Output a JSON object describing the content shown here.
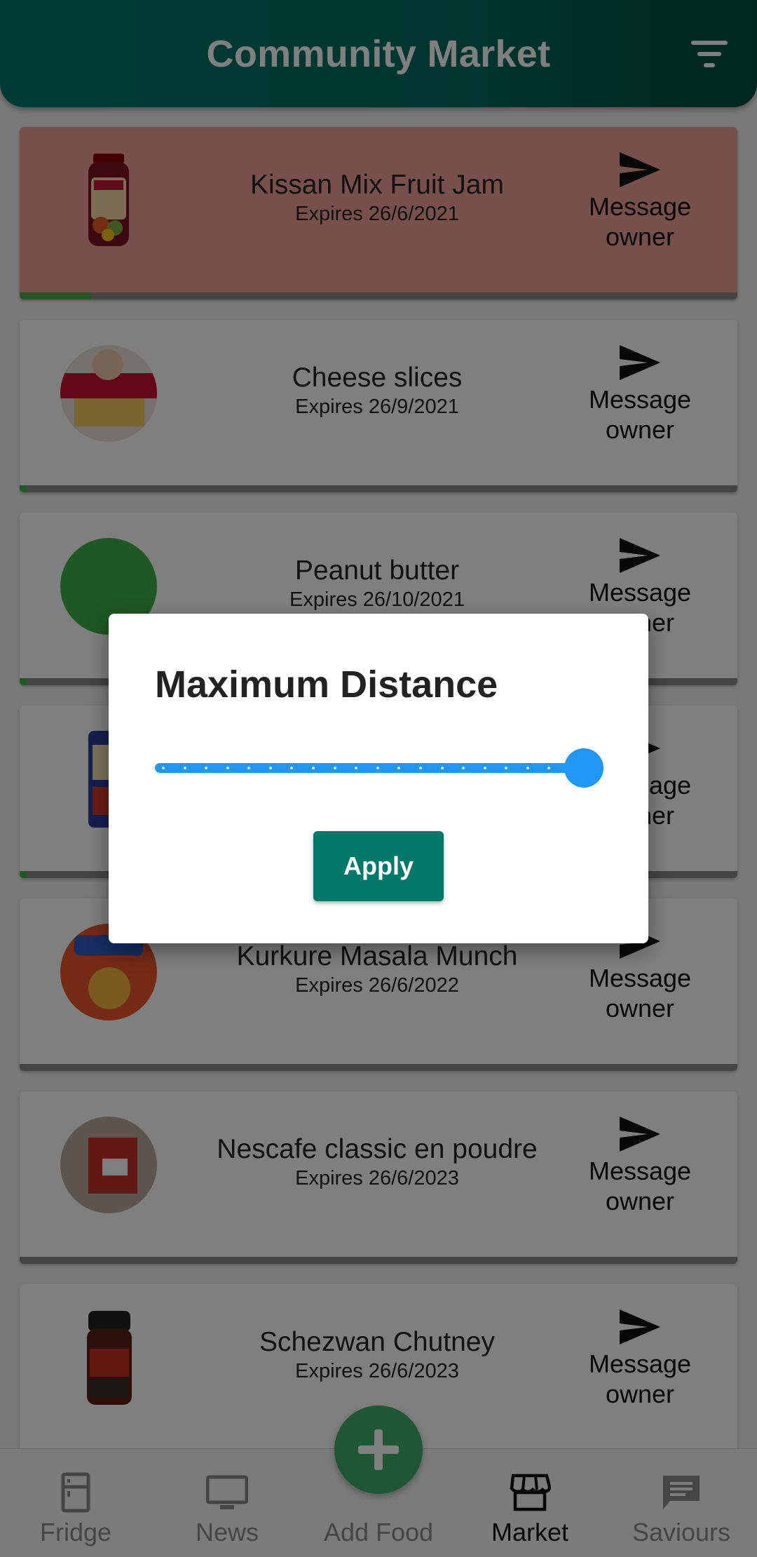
{
  "app_bar": {
    "title": "Community Market",
    "filter_icon": "filter-icon"
  },
  "items": [
    {
      "name": "Kissan Mix Fruit Jam",
      "expiry": "Expires 26/6/2021",
      "message_label": "Message owner",
      "image": "jam-jar",
      "expired": true,
      "freshness": 0.1
    },
    {
      "name": "Cheese slices",
      "expiry": "Expires 26/9/2021",
      "message_label": "Message owner",
      "image": "cheese-pack",
      "expired": false,
      "freshness": 0.01
    },
    {
      "name": "Peanut butter",
      "expiry": "Expires 26/10/2021",
      "message_label": "Message owner",
      "image": "placeholder-green",
      "expired": false,
      "freshness": 0.01
    },
    {
      "name": "",
      "expiry": "",
      "message_label": "Message owner",
      "image": "packet",
      "expired": false,
      "freshness": 0.01
    },
    {
      "name": "Kurkure Masala Munch",
      "expiry": "Expires 26/6/2022",
      "message_label": "Message owner",
      "image": "chips-pack",
      "expired": false,
      "freshness": 0.0
    },
    {
      "name": "Nescafe classic en poudre",
      "expiry": "Expires 26/6/2023",
      "message_label": "Message owner",
      "image": "coffee-jar",
      "expired": false,
      "freshness": 0.0
    },
    {
      "name": "Schezwan Chutney",
      "expiry": "Expires 26/6/2023",
      "message_label": "Message owner",
      "image": "chutney-jar",
      "expired": false,
      "freshness": 0.0
    }
  ],
  "dialog": {
    "title": "Maximum Distance",
    "slider_value": 1.0,
    "apply_label": "Apply"
  },
  "bottom_nav": {
    "items": [
      {
        "label": "Fridge",
        "icon": "fridge-icon",
        "active": false
      },
      {
        "label": "News",
        "icon": "monitor-icon",
        "active": false
      },
      {
        "label": "Add Food",
        "icon": "plus-icon",
        "active": false
      },
      {
        "label": "Market",
        "icon": "store-icon",
        "active": true
      },
      {
        "label": "Saviours",
        "icon": "chat-icon",
        "active": false
      }
    ]
  },
  "colors": {
    "primary": "#00796b",
    "expired_card": "#f0a097",
    "slider": "#2196f3",
    "fab": "#3fae6a"
  }
}
